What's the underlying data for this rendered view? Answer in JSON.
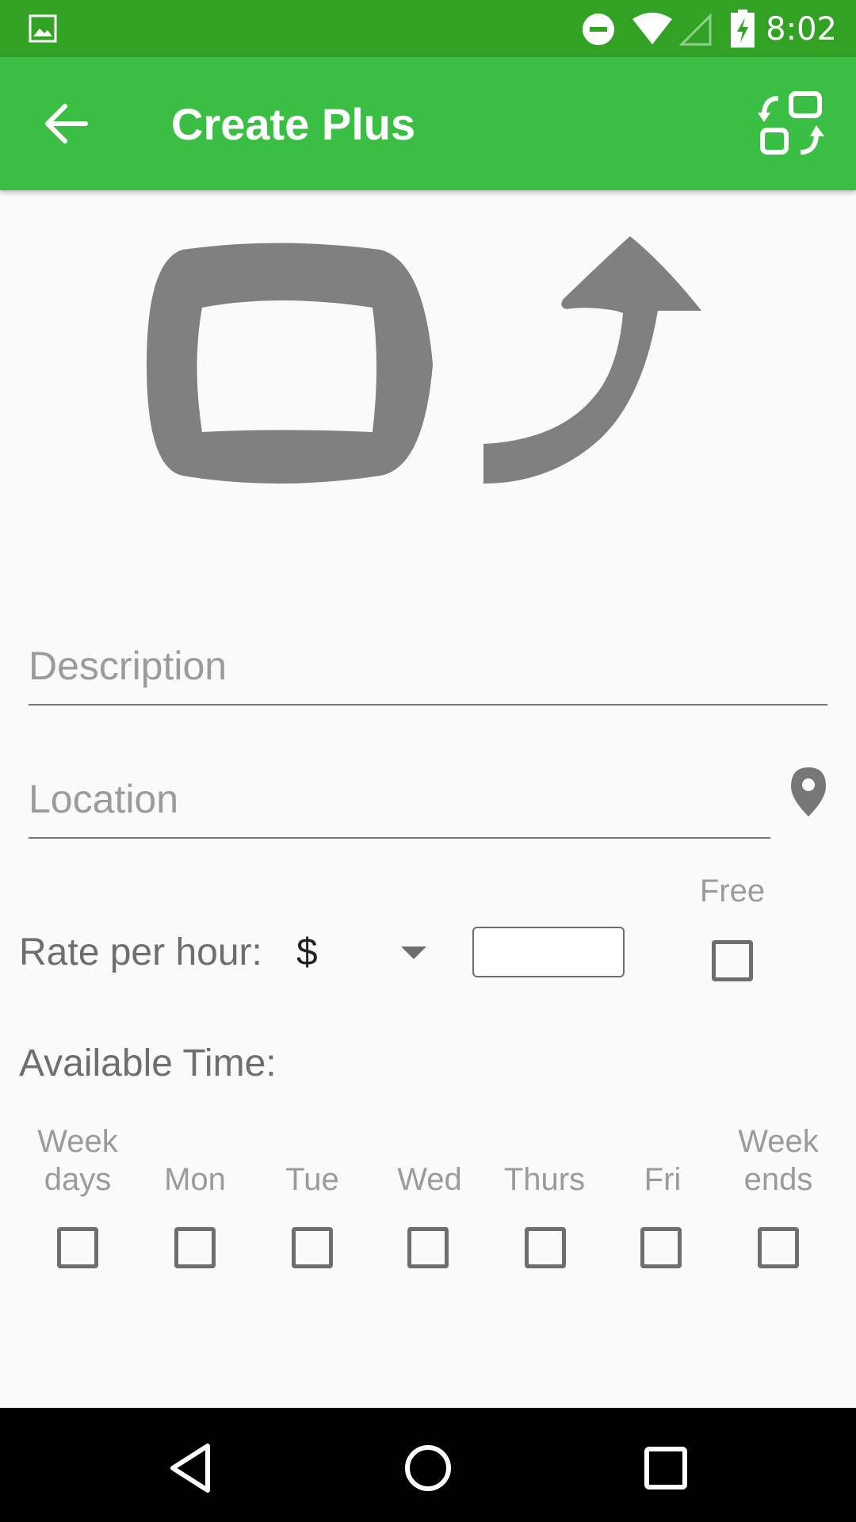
{
  "status_bar": {
    "time": "8:02",
    "icons": [
      "image-notification-icon",
      "do-not-disturb-icon",
      "wifi-icon",
      "cell-signal-icon",
      "battery-charging-icon"
    ]
  },
  "app_bar": {
    "title": "Create Plus",
    "back_icon": "arrow-back-icon",
    "action_icon": "switch-views-icon",
    "color": "#3bbe44",
    "status_color": "#31a224"
  },
  "form": {
    "description_placeholder": "Description",
    "description_value": "",
    "location_placeholder": "Location",
    "location_value": "",
    "location_icon": "map-pin-icon",
    "rate_label": "Rate per hour:",
    "currency": "$",
    "rate_value": "",
    "free_label": "Free",
    "free_checked": false
  },
  "availability": {
    "label": "Available Time:",
    "days": [
      {
        "label_line1": "Week",
        "label_line2": "days",
        "checked": false
      },
      {
        "label_line1": "",
        "label_line2": "Mon",
        "checked": false
      },
      {
        "label_line1": "",
        "label_line2": "Tue",
        "checked": false
      },
      {
        "label_line1": "",
        "label_line2": "Wed",
        "checked": false
      },
      {
        "label_line1": "",
        "label_line2": "Thurs",
        "checked": false
      },
      {
        "label_line1": "",
        "label_line2": "Fri",
        "checked": false
      },
      {
        "label_line1": "Week",
        "label_line2": "ends",
        "checked": false
      }
    ]
  },
  "nav_bar": {
    "buttons": [
      "back-triangle-icon",
      "home-circle-icon",
      "recents-square-icon"
    ]
  }
}
